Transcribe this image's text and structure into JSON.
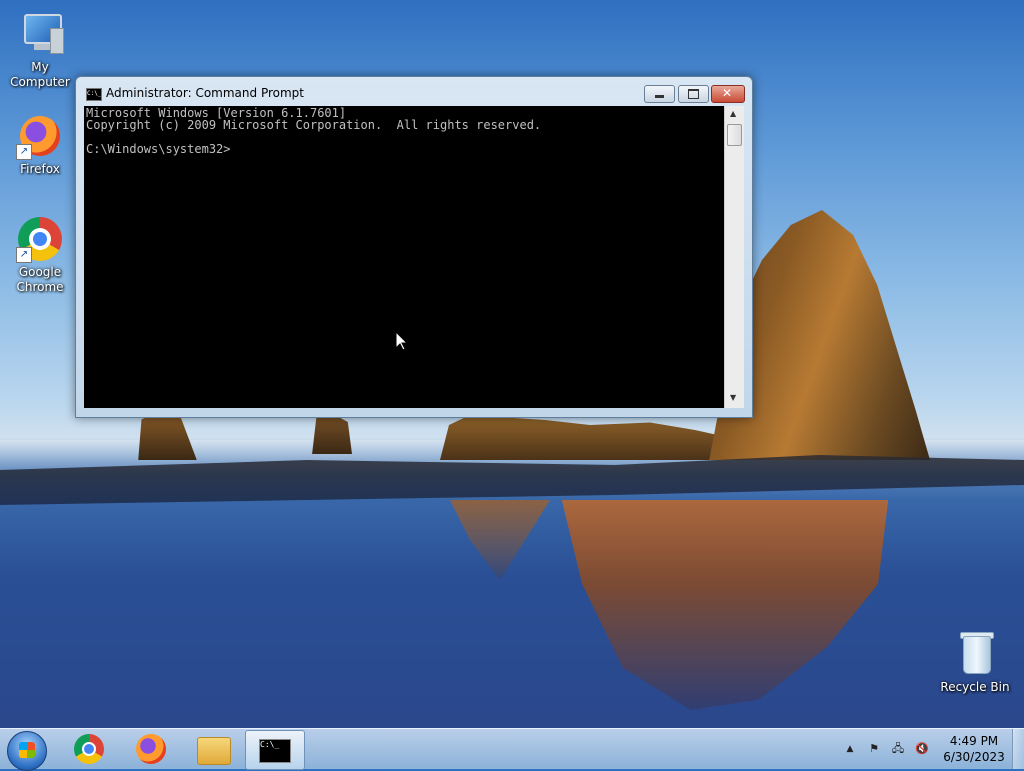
{
  "desktop": {
    "icons": [
      {
        "label": "My Computer",
        "icon": "computer-icon"
      },
      {
        "label": "Firefox",
        "icon": "firefox-icon"
      },
      {
        "label": "Google Chrome",
        "icon": "chrome-icon"
      },
      {
        "label": "Recycle Bin",
        "icon": "recycle-bin-icon"
      }
    ]
  },
  "window": {
    "title": "Administrator: Command Prompt",
    "console_lines": [
      "Microsoft Windows [Version 6.1.7601]",
      "Copyright (c) 2009 Microsoft Corporation.  All rights reserved.",
      "",
      "C:\\Windows\\system32>"
    ],
    "close_symbol": "✕"
  },
  "taskbar": {
    "pinned": [
      {
        "name": "Google Chrome",
        "icon": "chrome-icon"
      },
      {
        "name": "Firefox",
        "icon": "firefox-icon"
      },
      {
        "name": "Windows Explorer",
        "icon": "folder-icon"
      },
      {
        "name": "Command Prompt",
        "icon": "cmd-icon",
        "active": true
      }
    ],
    "tray": {
      "show_hidden": "▲",
      "icons": [
        "action-center-icon",
        "network-icon",
        "volume-muted-icon"
      ]
    },
    "clock": {
      "time": "4:49 PM",
      "date": "6/30/2023"
    }
  },
  "colors": {
    "console_bg": "#000000",
    "console_fg": "#c0c0c0",
    "close_button": "#c94a34"
  }
}
